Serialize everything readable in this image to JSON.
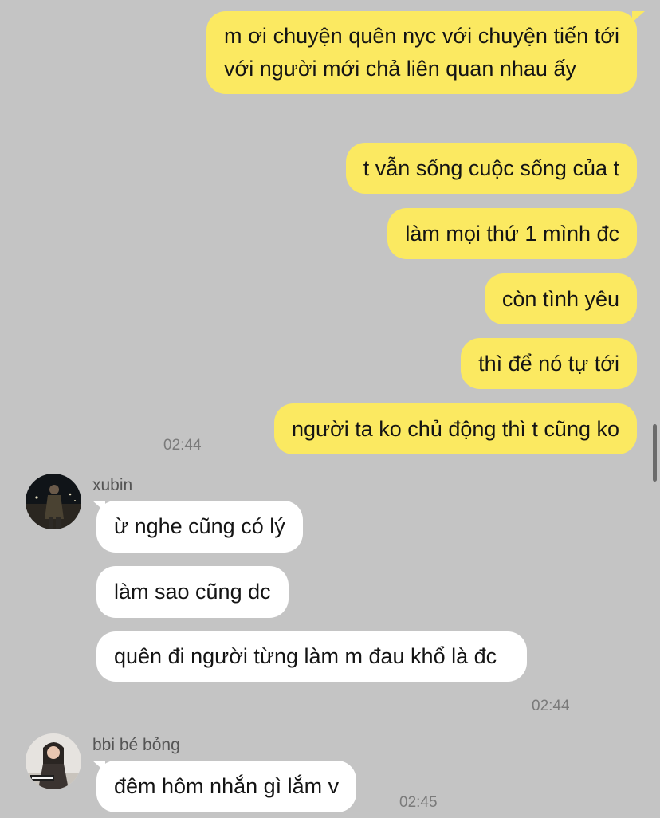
{
  "messages_outgoing": [
    {
      "text": "m ơi chuyện quên nyc với chuyện tiến tới với người mới chả liên quan nhau ấy"
    },
    {
      "text": "t vẫn sống cuộc sống của t"
    },
    {
      "text": "làm mọi thứ 1 mình đc"
    },
    {
      "text": "còn tình yêu"
    },
    {
      "text": "thì để nó tự tới"
    },
    {
      "text": "người ta ko chủ động thì t cũng ko"
    }
  ],
  "outgoing_time": "02:44",
  "group_xubin": {
    "sender": "xubin",
    "messages": [
      {
        "text": "ừ nghe cũng có lý"
      },
      {
        "text": "làm sao cũng dc"
      },
      {
        "text": "quên đi người từng làm m đau khổ là đc"
      }
    ],
    "time": "02:44"
  },
  "group_bbi": {
    "sender": "bbi bé bỏng",
    "messages": [
      {
        "text": "đêm hôm nhắn gì lắm v"
      }
    ],
    "time": "02:45"
  },
  "colors": {
    "background": "#c4c4c4",
    "outgoing_bubble": "#fbe961",
    "incoming_bubble": "#ffffff"
  }
}
